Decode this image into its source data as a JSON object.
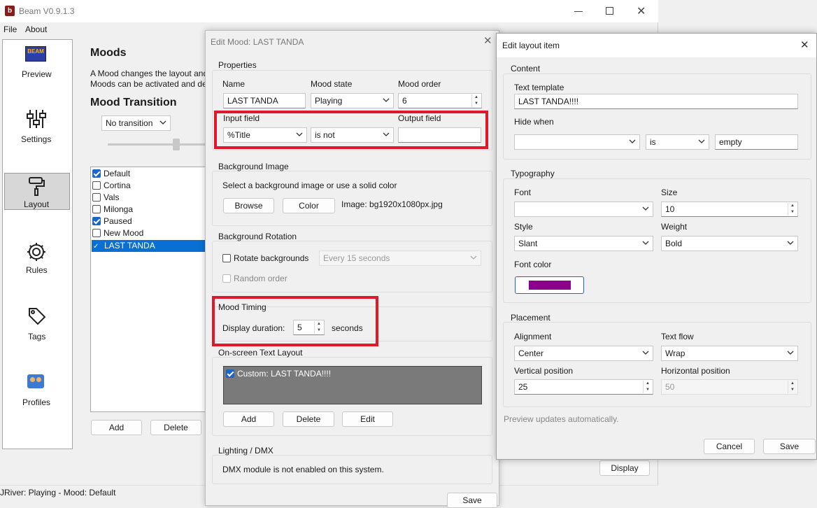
{
  "main_window": {
    "title": "Beam V0.9.1.3",
    "menu": [
      "File",
      "About"
    ],
    "sidebar": [
      {
        "label": "Preview",
        "icon": "beam-logo-icon"
      },
      {
        "label": "Settings",
        "icon": "sliders-icon"
      },
      {
        "label": "Layout",
        "icon": "paint-roller-icon"
      },
      {
        "label": "Rules",
        "icon": "gear-icon"
      },
      {
        "label": "Tags",
        "icon": "tag-icon"
      },
      {
        "label": "Profiles",
        "icon": "profiles-icon"
      }
    ],
    "heading": "Moods",
    "description_line1": "A Mood changes the layout and",
    "description_line2": "Moods can be activated and de",
    "transition_heading": "Mood Transition",
    "transition_value": "No transition",
    "mood_list": [
      {
        "label": "Default",
        "checked": true
      },
      {
        "label": "Cortina",
        "checked": false
      },
      {
        "label": "Vals",
        "checked": false
      },
      {
        "label": "Milonga",
        "checked": false
      },
      {
        "label": "Paused",
        "checked": true
      },
      {
        "label": "New Mood",
        "checked": false
      },
      {
        "label": "LAST TANDA",
        "checked": false,
        "selected": true
      }
    ],
    "add_label": "Add",
    "delete_label": "Delete",
    "display_label": "Display",
    "status": "JRiver: Playing - Mood: Default"
  },
  "edit_mood": {
    "title": "Edit Mood: LAST TANDA",
    "properties": {
      "group": "Properties",
      "name_label": "Name",
      "name_value": "LAST TANDA",
      "state_label": "Mood state",
      "state_value": "Playing",
      "order_label": "Mood order",
      "order_value": "6",
      "input_label": "Input field",
      "input_value": "%Title",
      "op_value": "is not",
      "output_label": "Output field",
      "output_value": ""
    },
    "background_image": {
      "group": "Background Image",
      "hint": "Select a background image or use a solid color",
      "browse": "Browse",
      "color": "Color",
      "image": "Image: bg1920x1080px.jpg"
    },
    "rotation": {
      "group": "Background Rotation",
      "rotate": "Rotate backgrounds",
      "interval": "Every 15 seconds",
      "random": "Random order"
    },
    "timing": {
      "group": "Mood Timing",
      "label": "Display duration:",
      "value": "5",
      "unit": "seconds"
    },
    "text_layout": {
      "group": "On-screen Text Layout",
      "item": "Custom: LAST TANDA!!!!",
      "add": "Add",
      "delete": "Delete",
      "edit": "Edit"
    },
    "dmx": {
      "group": "Lighting / DMX",
      "message": "DMX module is not enabled on this system."
    },
    "save": "Save"
  },
  "layout_item": {
    "title": "Edit layout item",
    "content": {
      "group": "Content",
      "template_label": "Text template",
      "template_value": "LAST TANDA!!!!",
      "hide_label": "Hide when",
      "hide_field": "",
      "hide_op": "is",
      "hide_value": "empty"
    },
    "typography": {
      "group": "Typography",
      "font_label": "Font",
      "font_value": "",
      "size_label": "Size",
      "size_value": "10",
      "style_label": "Style",
      "style_value": "Slant",
      "weight_label": "Weight",
      "weight_value": "Bold",
      "color_label": "Font color",
      "color_hex": "#8b008b"
    },
    "placement": {
      "group": "Placement",
      "align_label": "Alignment",
      "align_value": "Center",
      "flow_label": "Text flow",
      "flow_value": "Wrap",
      "vpos_label": "Vertical position",
      "vpos_value": "25",
      "hpos_label": "Horizontal position",
      "hpos_value": "50"
    },
    "note": "Preview updates automatically.",
    "cancel": "Cancel",
    "save": "Save"
  },
  "colors": {
    "accent": "#0078d7",
    "highlight": "#e0182a",
    "selection": "#0a6fd4"
  }
}
